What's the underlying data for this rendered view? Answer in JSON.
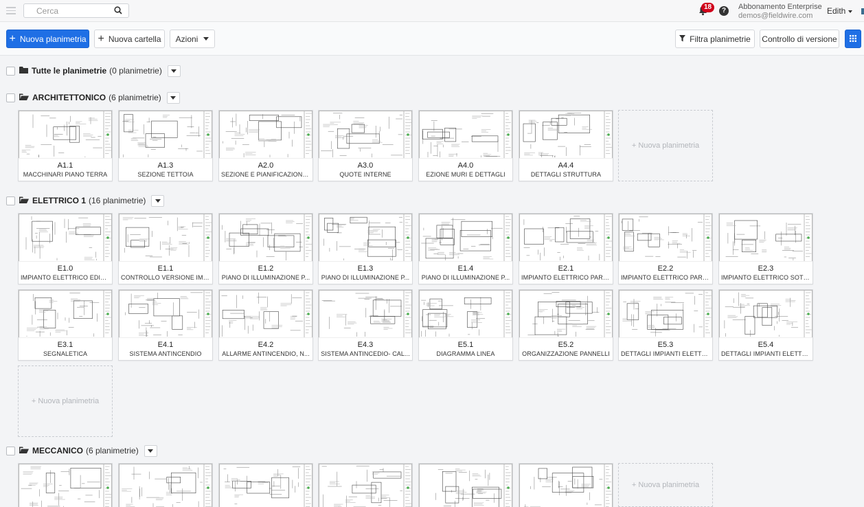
{
  "topbar": {
    "search_placeholder": "Cerca",
    "notification_count": "18",
    "help_label": "?",
    "plan_name": "Abbonamento Enterprise",
    "plan_email": "demos@fieldwire.com",
    "user_name": "Edith"
  },
  "toolbar": {
    "new_plan": "Nuova planimetria",
    "new_folder": "Nuova cartella",
    "actions": "Azioni",
    "filter": "Filtra planimetrie",
    "version_control": "Controllo di versione"
  },
  "new_plan_tile": "+ Nuova planimetria",
  "sections": [
    {
      "name": "Tutte le planimetrie",
      "count": "(0 planimetrie)",
      "cards": []
    },
    {
      "name": "ARCHITETTONICO",
      "count": "(6 planimetrie)",
      "cards": [
        {
          "code": "A1.1",
          "title": "MACCHINARI PIANO TERRA"
        },
        {
          "code": "A1.3",
          "title": "SEZIONE TETTOIA"
        },
        {
          "code": "A2.0",
          "title": "SEZIONE E PIANIFICAZIONE ..."
        },
        {
          "code": "A3.0",
          "title": "QUOTE INTERNE"
        },
        {
          "code": "A4.0",
          "title": "EZIONE MURI E DETTAGLI"
        },
        {
          "code": "A4.4",
          "title": "DETTAGLI STRUTTURA"
        }
      ]
    },
    {
      "name": "ELETTRICO 1",
      "count": "(16 planimetrie)",
      "cards": [
        {
          "code": "E1.0",
          "title": "IMPIANTO ELETTRICO EDIFI..."
        },
        {
          "code": "E1.1",
          "title": "CONTROLLO VERSIONE IMP..."
        },
        {
          "code": "E1.2",
          "title": "PIANO DI ILLUMINAZIONE P..."
        },
        {
          "code": "E1.3",
          "title": "PIANO DI ILLUMINAZIONE P..."
        },
        {
          "code": "E1.4",
          "title": "PIANO DI ILLUMINAZIONE P..."
        },
        {
          "code": "E2.1",
          "title": "IMPIANTO ELETTRICO PARZ..."
        },
        {
          "code": "E2.2",
          "title": "IMPIANTO ELETTRICO PARZ..."
        },
        {
          "code": "E2.3",
          "title": "IMPIANTO ELETTRICO SOTT..."
        },
        {
          "code": "E3.1",
          "title": "SEGNALETICA"
        },
        {
          "code": "E4.1",
          "title": "SISTEMA ANTINCENDIO"
        },
        {
          "code": "E4.2",
          "title": "ALLARME ANTINCENDIO, N..."
        },
        {
          "code": "E4.3",
          "title": "SISTEMA ANTINCEDIO- CAL..."
        },
        {
          "code": "E5.1",
          "title": "DIAGRAMMA LINEA"
        },
        {
          "code": "E5.2",
          "title": "ORGANIZZAZIONE PANNELLI"
        },
        {
          "code": "E5.3",
          "title": "DETTAGLI IMPIANTI ELETTRI..."
        },
        {
          "code": "E5.4",
          "title": "DETTAGLI IMPIANTI ELETTRI..."
        }
      ]
    },
    {
      "name": "MECCANICO",
      "count": "(6 planimetrie)",
      "cards": []
    }
  ],
  "colors": {
    "primary": "#1f6fe5",
    "badge": "#d0021b",
    "background": "#f3f4f6"
  }
}
